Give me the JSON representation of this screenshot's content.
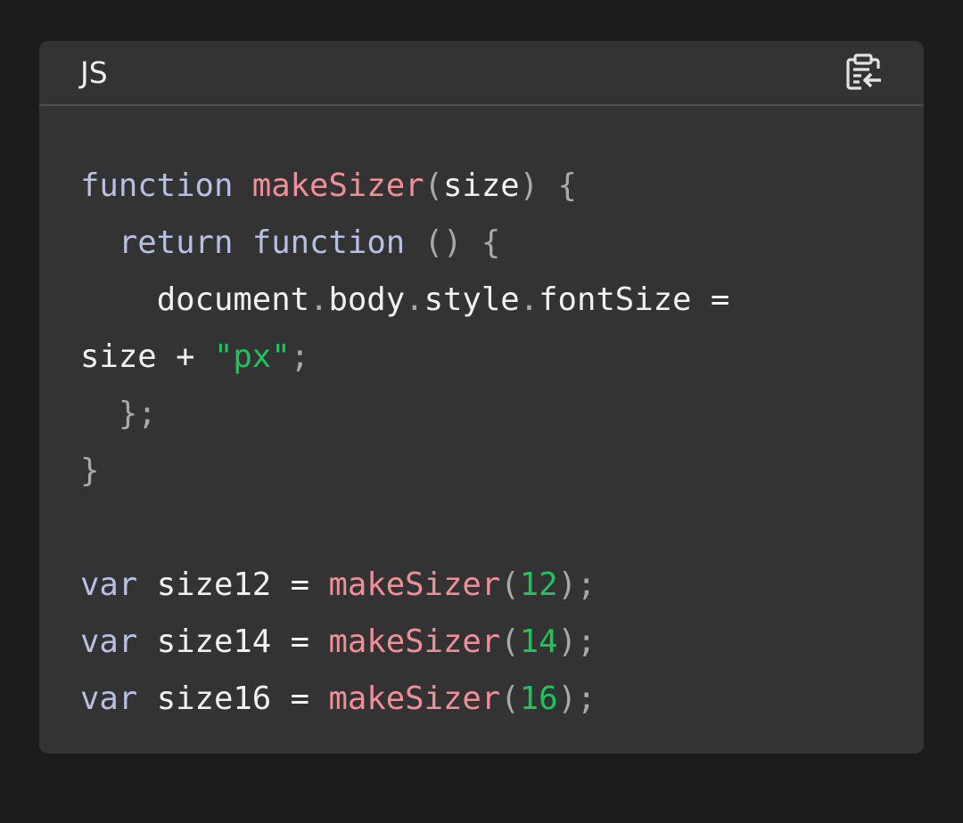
{
  "header": {
    "language_label": "JS",
    "copy_icon": "clipboard-copy-icon"
  },
  "colors": {
    "background": "#1c1c1c",
    "card": "#333333",
    "divider": "#4d4d4d",
    "keyword": "#b7bfe3",
    "function_name": "#ef8f98",
    "identifier": "#f1f1f1",
    "punctuation": "#a9a9a9",
    "string": "#1fc45e",
    "number": "#1fc45e"
  },
  "code": {
    "lines": [
      [
        {
          "t": "kw",
          "v": "function"
        },
        {
          "t": "sp",
          "v": " "
        },
        {
          "t": "fn",
          "v": "makeSizer"
        },
        {
          "t": "punct",
          "v": "("
        },
        {
          "t": "id",
          "v": "size"
        },
        {
          "t": "punct",
          "v": ")"
        },
        {
          "t": "sp",
          "v": " "
        },
        {
          "t": "punct",
          "v": "{"
        }
      ],
      [
        {
          "t": "sp",
          "v": "  "
        },
        {
          "t": "kw",
          "v": "return"
        },
        {
          "t": "sp",
          "v": " "
        },
        {
          "t": "kw",
          "v": "function"
        },
        {
          "t": "sp",
          "v": " "
        },
        {
          "t": "punct",
          "v": "()"
        },
        {
          "t": "sp",
          "v": " "
        },
        {
          "t": "punct",
          "v": "{"
        }
      ],
      [
        {
          "t": "sp",
          "v": "    "
        },
        {
          "t": "id",
          "v": "document"
        },
        {
          "t": "punct",
          "v": "."
        },
        {
          "t": "id",
          "v": "body"
        },
        {
          "t": "punct",
          "v": "."
        },
        {
          "t": "id",
          "v": "style"
        },
        {
          "t": "punct",
          "v": "."
        },
        {
          "t": "id",
          "v": "fontSize"
        },
        {
          "t": "sp",
          "v": " "
        },
        {
          "t": "id",
          "v": "="
        }
      ],
      [
        {
          "t": "id",
          "v": "size"
        },
        {
          "t": "sp",
          "v": " "
        },
        {
          "t": "id",
          "v": "+"
        },
        {
          "t": "sp",
          "v": " "
        },
        {
          "t": "str",
          "v": "\"px\""
        },
        {
          "t": "punct",
          "v": ";"
        }
      ],
      [
        {
          "t": "sp",
          "v": "  "
        },
        {
          "t": "punct",
          "v": "};"
        }
      ],
      [
        {
          "t": "punct",
          "v": "}"
        }
      ],
      [],
      [
        {
          "t": "kw",
          "v": "var"
        },
        {
          "t": "sp",
          "v": " "
        },
        {
          "t": "id",
          "v": "size12"
        },
        {
          "t": "sp",
          "v": " "
        },
        {
          "t": "id",
          "v": "="
        },
        {
          "t": "sp",
          "v": " "
        },
        {
          "t": "fn",
          "v": "makeSizer"
        },
        {
          "t": "punct",
          "v": "("
        },
        {
          "t": "num",
          "v": "12"
        },
        {
          "t": "punct",
          "v": ");"
        }
      ],
      [
        {
          "t": "kw",
          "v": "var"
        },
        {
          "t": "sp",
          "v": " "
        },
        {
          "t": "id",
          "v": "size14"
        },
        {
          "t": "sp",
          "v": " "
        },
        {
          "t": "id",
          "v": "="
        },
        {
          "t": "sp",
          "v": " "
        },
        {
          "t": "fn",
          "v": "makeSizer"
        },
        {
          "t": "punct",
          "v": "("
        },
        {
          "t": "num",
          "v": "14"
        },
        {
          "t": "punct",
          "v": ");"
        }
      ],
      [
        {
          "t": "kw",
          "v": "var"
        },
        {
          "t": "sp",
          "v": " "
        },
        {
          "t": "id",
          "v": "size16"
        },
        {
          "t": "sp",
          "v": " "
        },
        {
          "t": "id",
          "v": "="
        },
        {
          "t": "sp",
          "v": " "
        },
        {
          "t": "fn",
          "v": "makeSizer"
        },
        {
          "t": "punct",
          "v": "("
        },
        {
          "t": "num",
          "v": "16"
        },
        {
          "t": "punct",
          "v": ");"
        }
      ]
    ]
  }
}
